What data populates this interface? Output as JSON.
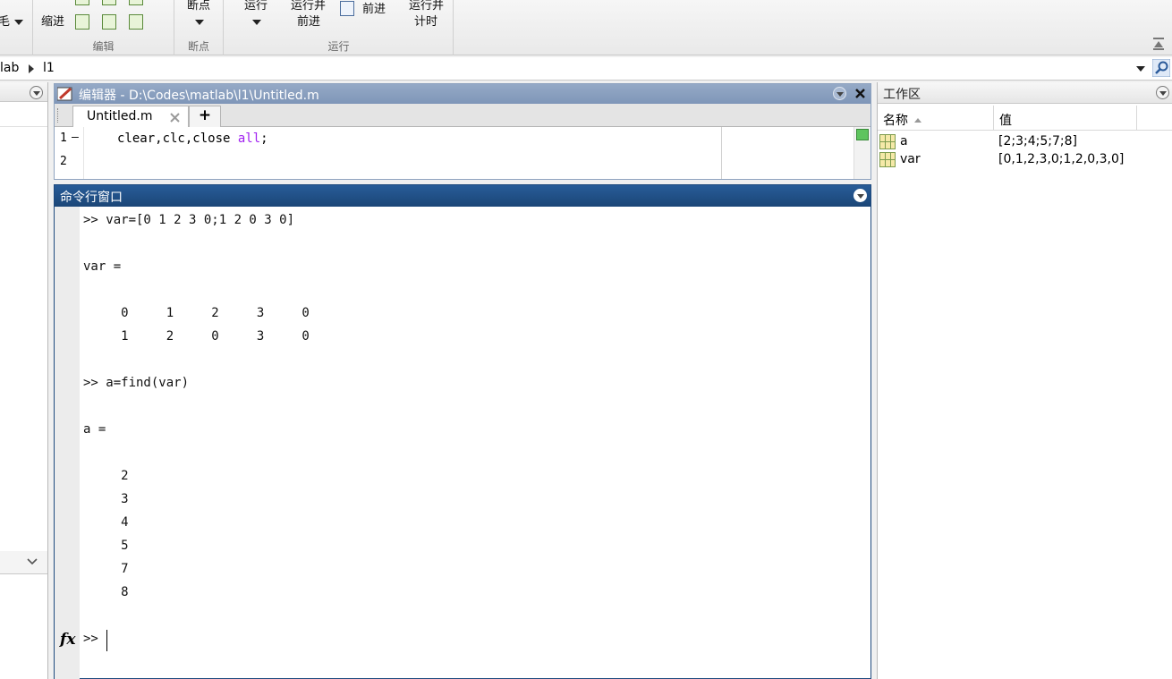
{
  "toolstrip": {
    "partial_left_label": "毛",
    "indent_label": "缩进",
    "edit_section": "编辑",
    "breakpoint_label": "断点",
    "breakpoint_section": "断点",
    "run_label": "运行",
    "run_advance_label_1": "运行并",
    "run_advance_label_2": "前进",
    "advance_label": "前进",
    "run_time_label_1": "运行并",
    "run_time_label_2": "计时",
    "run_section": "运行"
  },
  "address": {
    "crumb_1": "lab",
    "crumb_2": "l1"
  },
  "editor": {
    "title": "编辑器 - D:\\Codes\\matlab\\l1\\Untitled.m",
    "tab_label": "Untitled.m",
    "add_tab": "+",
    "lines": [
      {
        "num": "1",
        "mark": "—",
        "code": "clear,clc,close ",
        "str": "all",
        "tail": ";"
      },
      {
        "num": "2",
        "mark": "",
        "code": "",
        "str": "",
        "tail": ""
      }
    ]
  },
  "command_window": {
    "title": "命令行窗口",
    "lines": [
      ">> var=[0 1 2 3 0;1 2 0 3 0]",
      "",
      "var =",
      "",
      "     0     1     2     3     0",
      "     1     2     0     3     0",
      "",
      ">> a=find(var)",
      "",
      "a =",
      "",
      "     2",
      "     3",
      "     4",
      "     5",
      "     7",
      "     8",
      "",
      ""
    ],
    "prompt": ">>",
    "fx_label": "fx"
  },
  "workspace": {
    "title": "工作区",
    "col_name": "名称",
    "col_value": "值",
    "variables": [
      {
        "name": "a",
        "value": "[2;3;4;5;7;8]"
      },
      {
        "name": "var",
        "value": "[0,1,2,3,0;1,2,0,3,0]"
      }
    ]
  },
  "colors": {
    "editor_title_bg": "#8a9fbf",
    "cmd_title_bg": "#1f4f86",
    "string_purple": "#a020f0"
  }
}
